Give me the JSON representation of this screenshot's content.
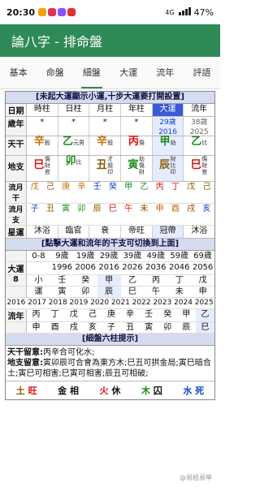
{
  "status": {
    "time": "20:30",
    "signal": "4G",
    "battery": "47%"
  },
  "app": {
    "title": "論八字 - 排命盤"
  },
  "tabs": [
    "基本",
    "命盤",
    "細盤",
    "大運",
    "流年",
    "評語"
  ],
  "notice": "[未起大運顯示小運,十步大運要打開設置]",
  "pillars": {
    "headers": [
      "日期",
      "時柱",
      "日柱",
      "月柱",
      "年柱",
      "大運",
      "流年"
    ],
    "age_row": [
      "歲年",
      "*",
      "*",
      "*",
      "*",
      "29歲\n2016",
      "38歲\n2025"
    ],
    "stems": [
      {
        "char": "辛",
        "god": "殺",
        "cls": "org"
      },
      {
        "char": "乙",
        "god": "元男",
        "cls": "grn"
      },
      {
        "char": "辛",
        "god": "殺",
        "cls": "org"
      },
      {
        "char": "丙",
        "god": "傷",
        "cls": "red"
      },
      {
        "char": "甲",
        "god": "劫",
        "cls": "grn"
      },
      {
        "char": "乙",
        "god": "比",
        "cls": "grn"
      }
    ],
    "branches": [
      {
        "char": "巳",
        "god": "傷財官",
        "cls": "red"
      },
      {
        "char": "卯",
        "god": "比",
        "cls": "grn"
      },
      {
        "char": "丑",
        "god": "才殺印",
        "cls": "brn"
      },
      {
        "char": "寅",
        "god": "劫傷財",
        "cls": "grn"
      },
      {
        "char": "辰",
        "god": "財比印",
        "cls": "brn"
      },
      {
        "char": "巳",
        "god": "傷財官",
        "cls": "red"
      }
    ],
    "flow_month_stem": [
      "戊",
      "己",
      "庚",
      "辛",
      "壬",
      "癸",
      "甲",
      "乙",
      "丙",
      "丁",
      "戊",
      "己"
    ],
    "flow_month_branch": [
      "子",
      "丑",
      "寅",
      "卯",
      "辰",
      "巳",
      "午",
      "未",
      "申",
      "酉",
      "戌",
      "亥"
    ],
    "stars": [
      "沐浴",
      "臨官",
      "衰",
      "帝旺",
      "冠帶",
      "沐浴"
    ]
  },
  "dayun_notice": "[點擊大運和流年的干支可切換到上面]",
  "dayun": {
    "ages": [
      "0-8",
      "9歲",
      "19歲",
      "29歲",
      "39歲",
      "49歲",
      "59歲",
      "69歲"
    ],
    "years": [
      "",
      "1996",
      "2006",
      "2016",
      "2026",
      "2036",
      "2046",
      "2056"
    ],
    "label": "大運",
    "count": "8",
    "stems": [
      "小",
      "壬",
      "癸",
      "甲",
      "乙",
      "丙",
      "丁",
      "戊"
    ],
    "branches": [
      "運",
      "寅",
      "卯",
      "辰",
      "巳",
      "午",
      "未",
      "申"
    ]
  },
  "liunian": {
    "years": [
      "2016",
      "2017",
      "2018",
      "2019",
      "2020",
      "2021",
      "2022",
      "2023",
      "2024",
      "2025"
    ],
    "label": "流年",
    "stems": [
      "丙",
      "丁",
      "戊",
      "己",
      "庚",
      "辛",
      "壬",
      "癸",
      "甲",
      "乙"
    ],
    "branches": [
      "申",
      "酉",
      "戌",
      "亥",
      "子",
      "丑",
      "寅",
      "卯",
      "辰",
      "巳"
    ]
  },
  "tips_header": "[細盤六柱提示]",
  "tips": {
    "heaven_label": "天干留意:",
    "heaven_text": "丙辛合可化水;",
    "earth_label": "地支留意:",
    "earth_text": "寅卯辰可合會為東方木;巳丑可拱金局;寅巳暗合土;寅巳可相害;巳寅可相害;辰丑可相破;"
  },
  "elements": [
    {
      "name": "土",
      "state": "旺"
    },
    {
      "name": "金",
      "state": "相"
    },
    {
      "name": "火",
      "state": "休"
    },
    {
      "name": "木",
      "state": "囚"
    },
    {
      "name": "水",
      "state": "死"
    }
  ],
  "watermark": "@易經易學"
}
